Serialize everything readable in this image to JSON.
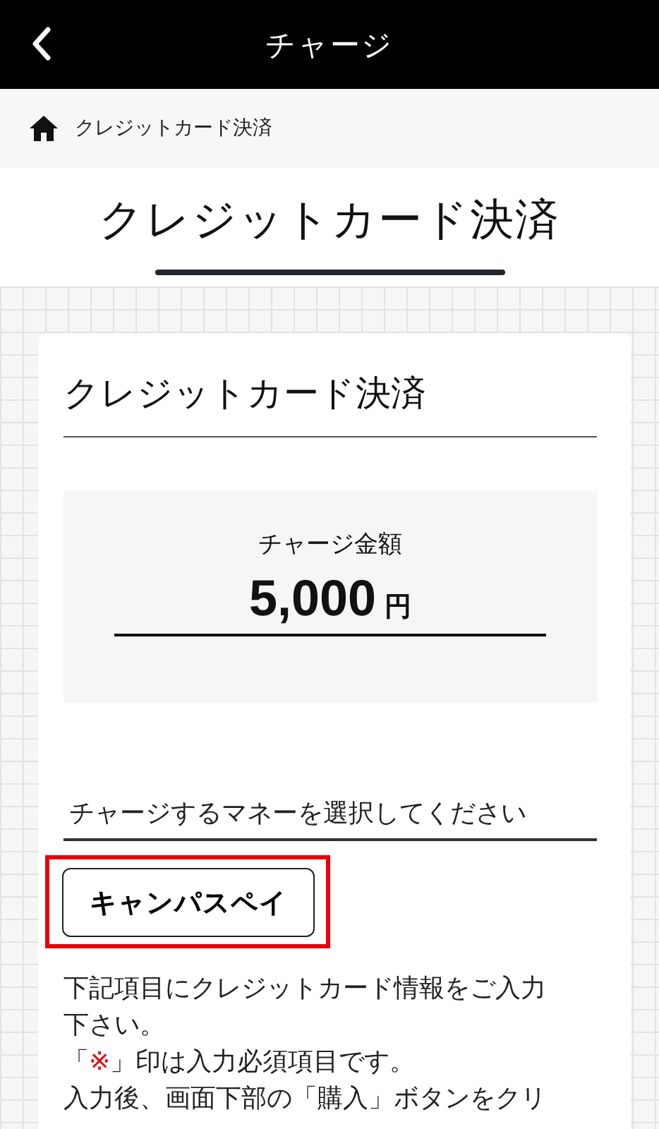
{
  "header": {
    "title": "チャージ"
  },
  "breadcrumb": {
    "label": "クレジットカード決済"
  },
  "page_title": "クレジットカード決済",
  "card": {
    "title": "クレジットカード決済",
    "amount": {
      "label": "チャージ金額",
      "value": "5,000",
      "unit": "円"
    },
    "money_select": {
      "label": "チャージするマネーを選択してください",
      "options": [
        {
          "label": "キャンパスペイ",
          "highlighted": true
        }
      ]
    },
    "instructions": [
      {
        "kind": "plain",
        "text": "下記項目にクレジットカード情報をご入力下さい。"
      },
      {
        "kind": "mark",
        "before": "「",
        "mark": "※",
        "after": "」印は入力必須項目です。"
      },
      {
        "kind": "plain",
        "text": "入力後、画面下部の「購入」ボタンをクリ"
      }
    ]
  }
}
